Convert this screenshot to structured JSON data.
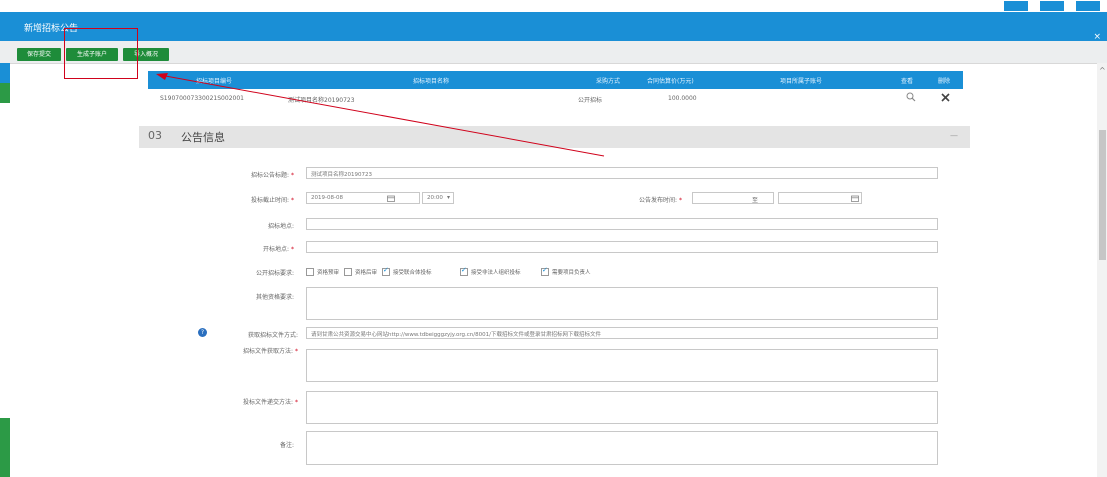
{
  "window": {
    "title": "新增招标公告",
    "close_glyph": "×"
  },
  "toolbar": {
    "buttons": [
      "保存提交",
      "生成子账户",
      "导入概况"
    ]
  },
  "table": {
    "headers": [
      "招标项目编号",
      "招标项目名称",
      "采购方式",
      "合同估算价(万元)",
      "项目所属子账号",
      "查看",
      "删除"
    ],
    "row": {
      "code": "S19070007330021S002001",
      "name": "测试项目名称20190723",
      "method": "公开招标",
      "amount": "100.0000",
      "subaccount": "",
      "view_icon": "magnifier",
      "delete_icon": "x"
    }
  },
  "section": {
    "icon_text": "03",
    "title": "公告信息",
    "collapse_glyph": "—"
  },
  "form": {
    "title": {
      "label": "招标公告标题:",
      "value": "测试项目名称20190723"
    },
    "deadline": {
      "label": "投标截止时间:",
      "date": "2019-08-08",
      "time": "20:00",
      "time_caret": "▾",
      "calendar_icon": "calendar"
    },
    "publish": {
      "label": "公告发布时间:",
      "req": "*",
      "sep": "至"
    },
    "location": {
      "label": "招标地点:"
    },
    "contact": {
      "label": "开标地点:",
      "req": "*"
    },
    "qualification": {
      "label": "公开招标要求:",
      "options": [
        {
          "label": "资格预审",
          "checked": false
        },
        {
          "label": "资格后审",
          "checked": false
        },
        {
          "label": "接受联合体投标",
          "checked": true
        },
        {
          "label": "接受非法人组织投标",
          "checked": true
        },
        {
          "label": "需要项目负责人",
          "checked": true
        }
      ]
    },
    "other_req": {
      "label": "其他资格要求:"
    },
    "doc_access": {
      "label": "获取招标文件方式:",
      "value": "请到甘肃公共资源交易中心网站http://www.tdbeigggzyjy.org.cn/8001/下载招标文件或登录甘肃招标网下载招标文件"
    },
    "doc_method": {
      "label": "招标文件获取方法:",
      "req": "*"
    },
    "submit_method": {
      "label": "投标文件递交方法:",
      "req": "*"
    },
    "remarks": {
      "label": "备注:"
    }
  }
}
